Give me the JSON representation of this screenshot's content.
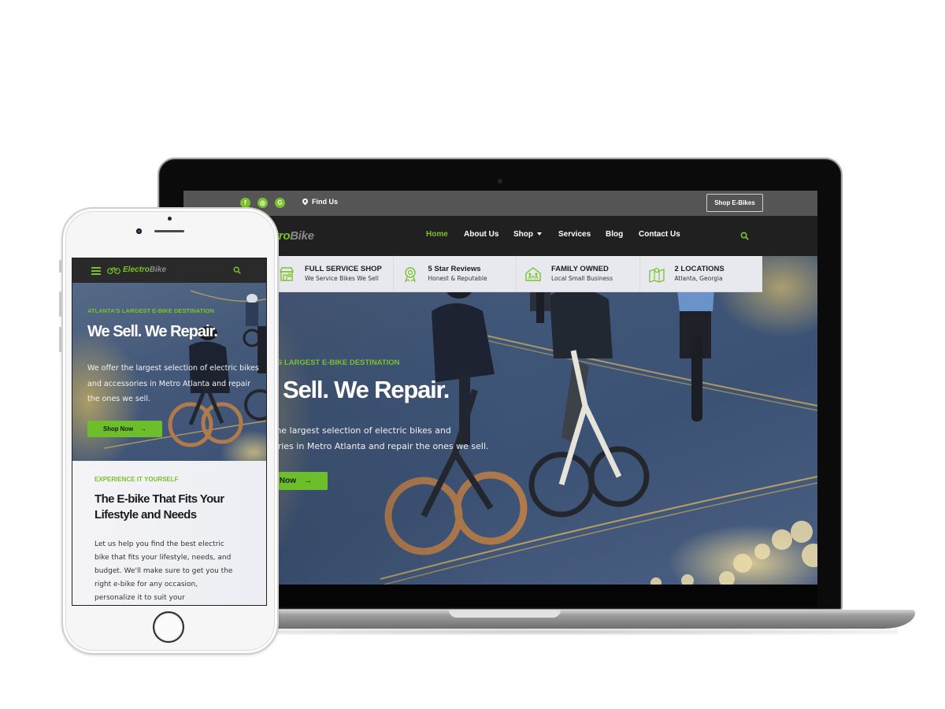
{
  "colors": {
    "accent": "#7ac12a",
    "topbar_bg": "#555555",
    "navbar_bg": "#202020",
    "features_bg": "#e8e9ee",
    "button_bg": "#6cbf2a"
  },
  "desktop": {
    "topbar": {
      "social_icons": [
        {
          "name": "facebook-icon",
          "glyph": "f"
        },
        {
          "name": "instagram-icon",
          "glyph": "◎"
        },
        {
          "name": "google-icon",
          "glyph": "G"
        }
      ],
      "find_us": "Find Us",
      "shop_ebikes": "Shop E-Bikes"
    },
    "navbar": {
      "logo_part1": "Electro",
      "logo_part2": "Bike",
      "logo_visible_part1": "ectro",
      "items": [
        {
          "label": "Home",
          "active": true
        },
        {
          "label": "About Us",
          "active": false
        },
        {
          "label": "Shop",
          "active": false,
          "dropdown": true
        },
        {
          "label": "Services",
          "active": false
        },
        {
          "label": "Blog",
          "active": false
        },
        {
          "label": "Contact Us",
          "active": false
        }
      ],
      "search_icon": "search-icon"
    },
    "features": [
      {
        "icon": "storefront-icon",
        "title": "FULL SERVICE SHOP",
        "subtitle": "We Service Bikes We Sell"
      },
      {
        "icon": "award-badge-icon",
        "title": "5 Star Reviews",
        "subtitle": "Honest & Reputable"
      },
      {
        "icon": "family-house-icon",
        "title": "FAMILY OWNED",
        "subtitle": "Local Small Business"
      },
      {
        "icon": "map-pin-icon",
        "title": "2 LOCATIONS",
        "subtitle": "Atlanta, Georgia"
      }
    ],
    "hero": {
      "kicker_visible": "S LARGEST E-BIKE DESTINATION",
      "title_visible": "Sell. We Repair.",
      "text_line1_visible": "the largest selection of electric bikes and",
      "text_line2_visible": "ories in Metro Atlanta and repair the ones we sell.",
      "button_visible": "Now",
      "button_arrow": "→"
    }
  },
  "mobile": {
    "nav": {
      "logo_part1": "Electro",
      "logo_part2": "Bike"
    },
    "hero": {
      "kicker": "ATLANTA'S LARGEST E-BIKE DESTINATION",
      "title": "We Sell. We Repair.",
      "text": "We offer the largest selection of electric bikes and accessories in Metro Atlanta and repair the ones we sell.",
      "button": "Shop Now",
      "button_arrow": "→"
    },
    "section": {
      "kicker": "EXPERIENCE IT YOURSELF",
      "heading": "The E-bike That Fits Your Lifestyle and Needs",
      "body": "Let us help you find the best electric bike that fits your lifestyle, needs, and budget. We'll make sure to get you the right e-bike for any occasion, personalize it to suit your"
    }
  }
}
